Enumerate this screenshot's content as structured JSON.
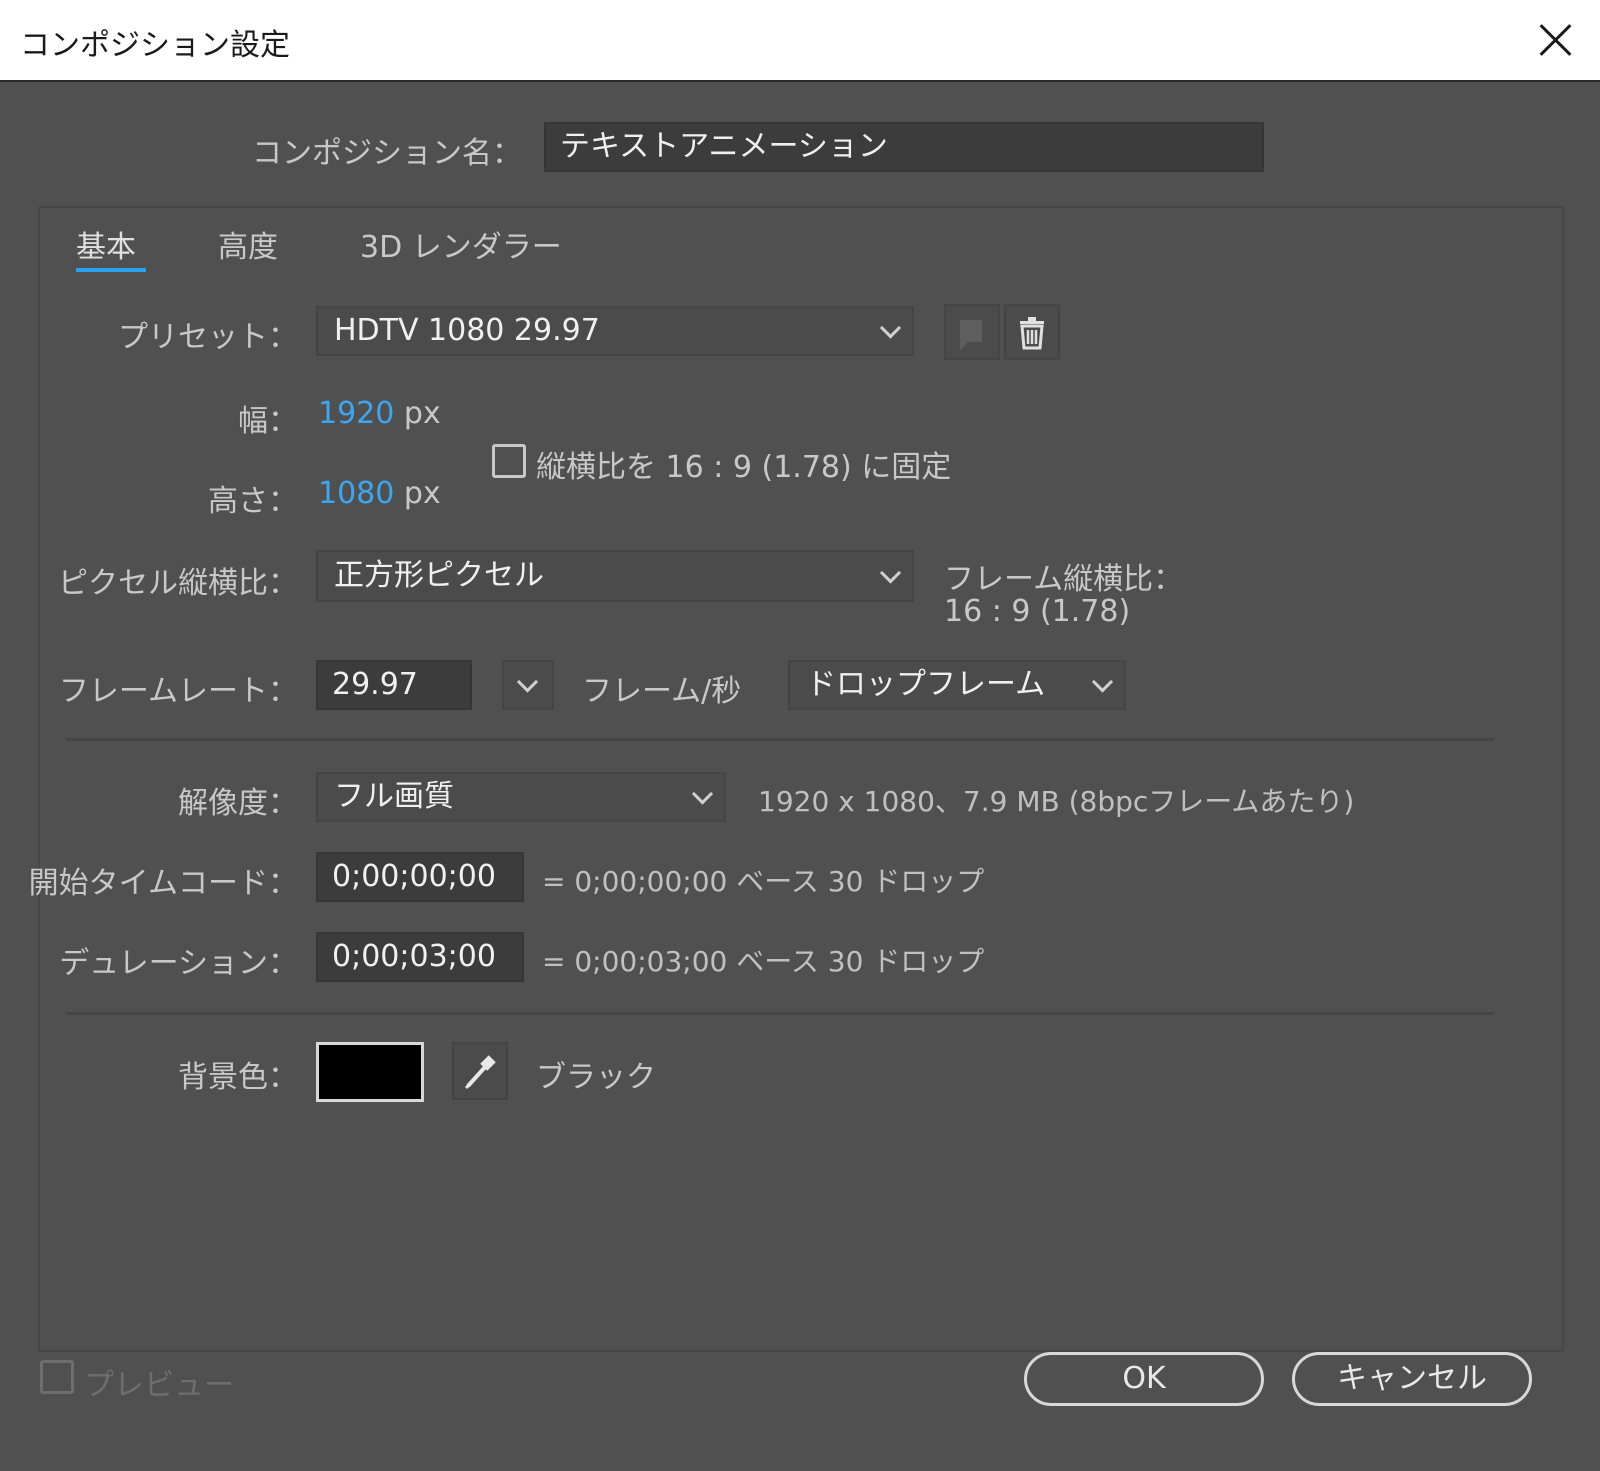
{
  "window": {
    "title": "コンポジション設定"
  },
  "comp_name": {
    "label": "コンポジション名：",
    "value": "テキストアニメーション"
  },
  "tabs": [
    {
      "label": "基本",
      "active": true
    },
    {
      "label": "高度",
      "active": false
    },
    {
      "label": "3D レンダラー",
      "active": false
    }
  ],
  "preset": {
    "label": "プリセット：",
    "value": "HDTV 1080 29.97"
  },
  "width": {
    "label": "幅：",
    "value": "1920",
    "unit": "px"
  },
  "height": {
    "label": "高さ：",
    "value": "1080",
    "unit": "px"
  },
  "lock_aspect": {
    "label": "縦横比を 16 : 9 (1.78) に固定",
    "checked": false
  },
  "pixel_aspect": {
    "label": "ピクセル縦横比：",
    "value": "正方形ピクセル"
  },
  "frame_aspect": {
    "label": "フレーム縦横比：",
    "value": "16 : 9 (1.78)"
  },
  "frame_rate": {
    "label": "フレームレート：",
    "value": "29.97",
    "unit": "フレーム/秒",
    "mode": "ドロップフレーム"
  },
  "resolution": {
    "label": "解像度：",
    "value": "フル画質",
    "info": "1920 x 1080、7.9 MB (8bpcフレームあたり)"
  },
  "start_timecode": {
    "label": "開始タイムコード：",
    "value": "0;00;00;00",
    "info": "= 0;00;00;00  ベース 30  ドロップ"
  },
  "duration": {
    "label": "デュレーション：",
    "value": "0;00;03;00",
    "info": "= 0;00;03;00  ベース 30  ドロップ"
  },
  "background": {
    "label": "背景色：",
    "color": "#000000",
    "name": "ブラック"
  },
  "footer": {
    "preview_label": "プレビュー",
    "ok_label": "OK",
    "cancel_label": "キャンセル"
  },
  "colors": {
    "accent": "#3ea5f0",
    "dialog_bg": "#505050"
  }
}
